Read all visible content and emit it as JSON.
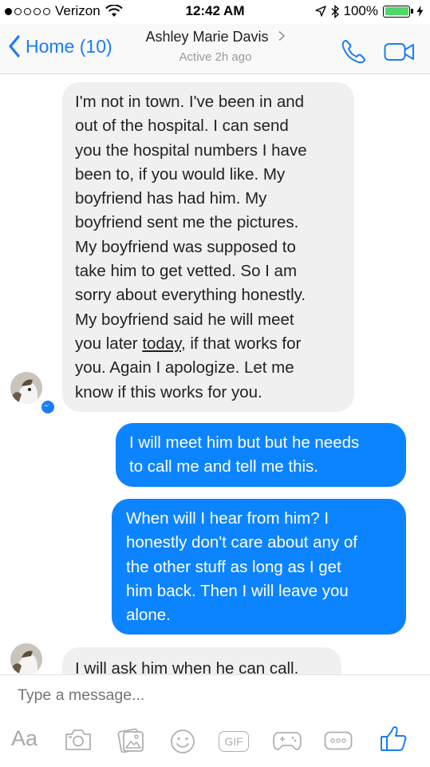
{
  "status_bar": {
    "carrier": "Verizon",
    "time": "12:42 AM",
    "battery": "100%"
  },
  "header": {
    "back_label": "Home (10)",
    "contact_name": "Ashley Marie Davis",
    "contact_status": "Active 2h ago"
  },
  "messages": [
    {
      "direction": "incoming",
      "lines": [
        "I'm not in town. I've been in and",
        "out of the hospital. I can send",
        "you the hospital numbers I have",
        "been to, if you would like. My",
        "boyfriend has had him. My",
        "boyfriend sent me the pictures.",
        "My boyfriend was supposed to",
        "take him to get vetted. So I am",
        "sorry about everything honestly.",
        "My boyfriend said he will meet"
      ],
      "line11_pre": "you later ",
      "line11_underlined": "today",
      "line11_post": ", if that works for",
      "lines_end": [
        "you. Again I apologize. Let me",
        "know if this works for you."
      ]
    },
    {
      "direction": "outgoing",
      "lines": [
        "I will meet him but but he needs",
        "to call me and tell me this."
      ]
    },
    {
      "direction": "outgoing",
      "lines": [
        "When will I hear from him? I",
        "honestly don't care about any of",
        "the other stuff as long as I get",
        "him back. Then I will leave you",
        "alone."
      ]
    },
    {
      "direction": "incoming",
      "lines": [
        "I will ask him when he can call."
      ]
    }
  ],
  "composer": {
    "placeholder": "Type a message...",
    "aa_label": "Aa",
    "gif_label": "GIF"
  },
  "colors": {
    "accent": "#1a7df7",
    "outgoing_bubble": "#0d84ff",
    "incoming_bubble": "#f1f0f0",
    "battery": "#4cd964"
  },
  "icons": [
    "signal-dots-icon",
    "wifi-icon",
    "location-arrow-icon",
    "bluetooth-icon",
    "battery-icon",
    "charging-icon",
    "back-chevron-icon",
    "chevron-right-icon",
    "phone-icon",
    "video-camera-icon",
    "messenger-badge-icon",
    "camera-icon",
    "photo-gallery-icon",
    "emoji-icon",
    "gif-icon",
    "game-controller-icon",
    "more-icon",
    "thumbs-up-icon"
  ]
}
